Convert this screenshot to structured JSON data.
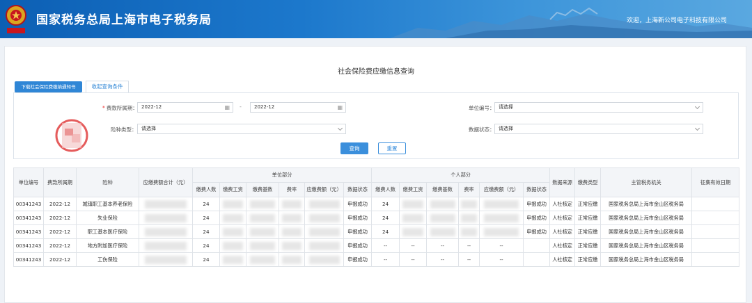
{
  "header": {
    "site_title": "国家税务总局上海市电子税务局",
    "welcome": "欢迎，上海新公司电子科技有限公司",
    "emblem_caption": "中国税务"
  },
  "page": {
    "title": "社会保险费应缴信息查询",
    "download_button": "下载社会保险费缴纳通知书",
    "collapse_tab": "收起查询条件"
  },
  "query": {
    "period_label": "费款所属期：",
    "period_start": "2022-12",
    "period_end": "2022-12",
    "dash": "-",
    "unit_no_label": "单位编号：",
    "unit_no_value": "请选择",
    "insurance_label": "险种类型：",
    "insurance_value": "请选择",
    "status_label": "数据状态：",
    "status_value": "请选择",
    "query_button": "查询",
    "reset_button": "重置"
  },
  "table": {
    "headers": {
      "unit_no": "单位编号",
      "period": "费款所属期",
      "insurance": "险种",
      "total": "应缴费额合计（元）",
      "unit_part": "单位部分",
      "personal_part": "个人部分",
      "source": "数据来源",
      "fee_type": "缴费类型",
      "tax_office": "主管税务机关",
      "valid_date": "征集有效日期"
    },
    "sub_headers": {
      "count": "缴费人数",
      "wage": "缴费工资",
      "base": "缴费基数",
      "rate": "费率",
      "amount": "应缴费额（元）",
      "status": "数据状态"
    },
    "rows": [
      {
        "unit_no": "00341243",
        "period": "2022-12",
        "insurance": "城镇职工基本养老保险",
        "unit_count": "24",
        "unit_status": "申报成功",
        "p_count": "24",
        "p_status": "申报成功",
        "p_dash": "",
        "source": "人社核定",
        "fee_type": "正常应缴",
        "office": "国家税务总局上海市金山区税务局"
      },
      {
        "unit_no": "00341243",
        "period": "2022-12",
        "insurance": "失业保险",
        "unit_count": "24",
        "unit_status": "申报成功",
        "p_count": "24",
        "p_status": "申报成功",
        "p_dash": "",
        "source": "人社核定",
        "fee_type": "正常应缴",
        "office": "国家税务总局上海市金山区税务局"
      },
      {
        "unit_no": "00341243",
        "period": "2022-12",
        "insurance": "职工基本医疗保险",
        "unit_count": "24",
        "unit_status": "申报成功",
        "p_count": "24",
        "p_status": "申报成功",
        "p_dash": "",
        "source": "人社核定",
        "fee_type": "正常应缴",
        "office": "国家税务总局上海市金山区税务局"
      },
      {
        "unit_no": "00341243",
        "period": "2022-12",
        "insurance": "地方附加医疗保险",
        "unit_count": "24",
        "unit_status": "申报成功",
        "p_count": "--",
        "p_status": "",
        "p_dash": "--",
        "source": "人社核定",
        "fee_type": "正常应缴",
        "office": "国家税务总局上海市金山区税务局"
      },
      {
        "unit_no": "00341243",
        "period": "2022-12",
        "insurance": "工伤保险",
        "unit_count": "24",
        "unit_status": "申报成功",
        "p_count": "--",
        "p_status": "",
        "p_dash": "--",
        "source": "人社核定",
        "fee_type": "正常应缴",
        "office": "国家税务总局上海市金山区税务局"
      }
    ]
  },
  "colors": {
    "primary": "#2f86d6",
    "success": "#2ea32e",
    "required": "#e33333"
  }
}
